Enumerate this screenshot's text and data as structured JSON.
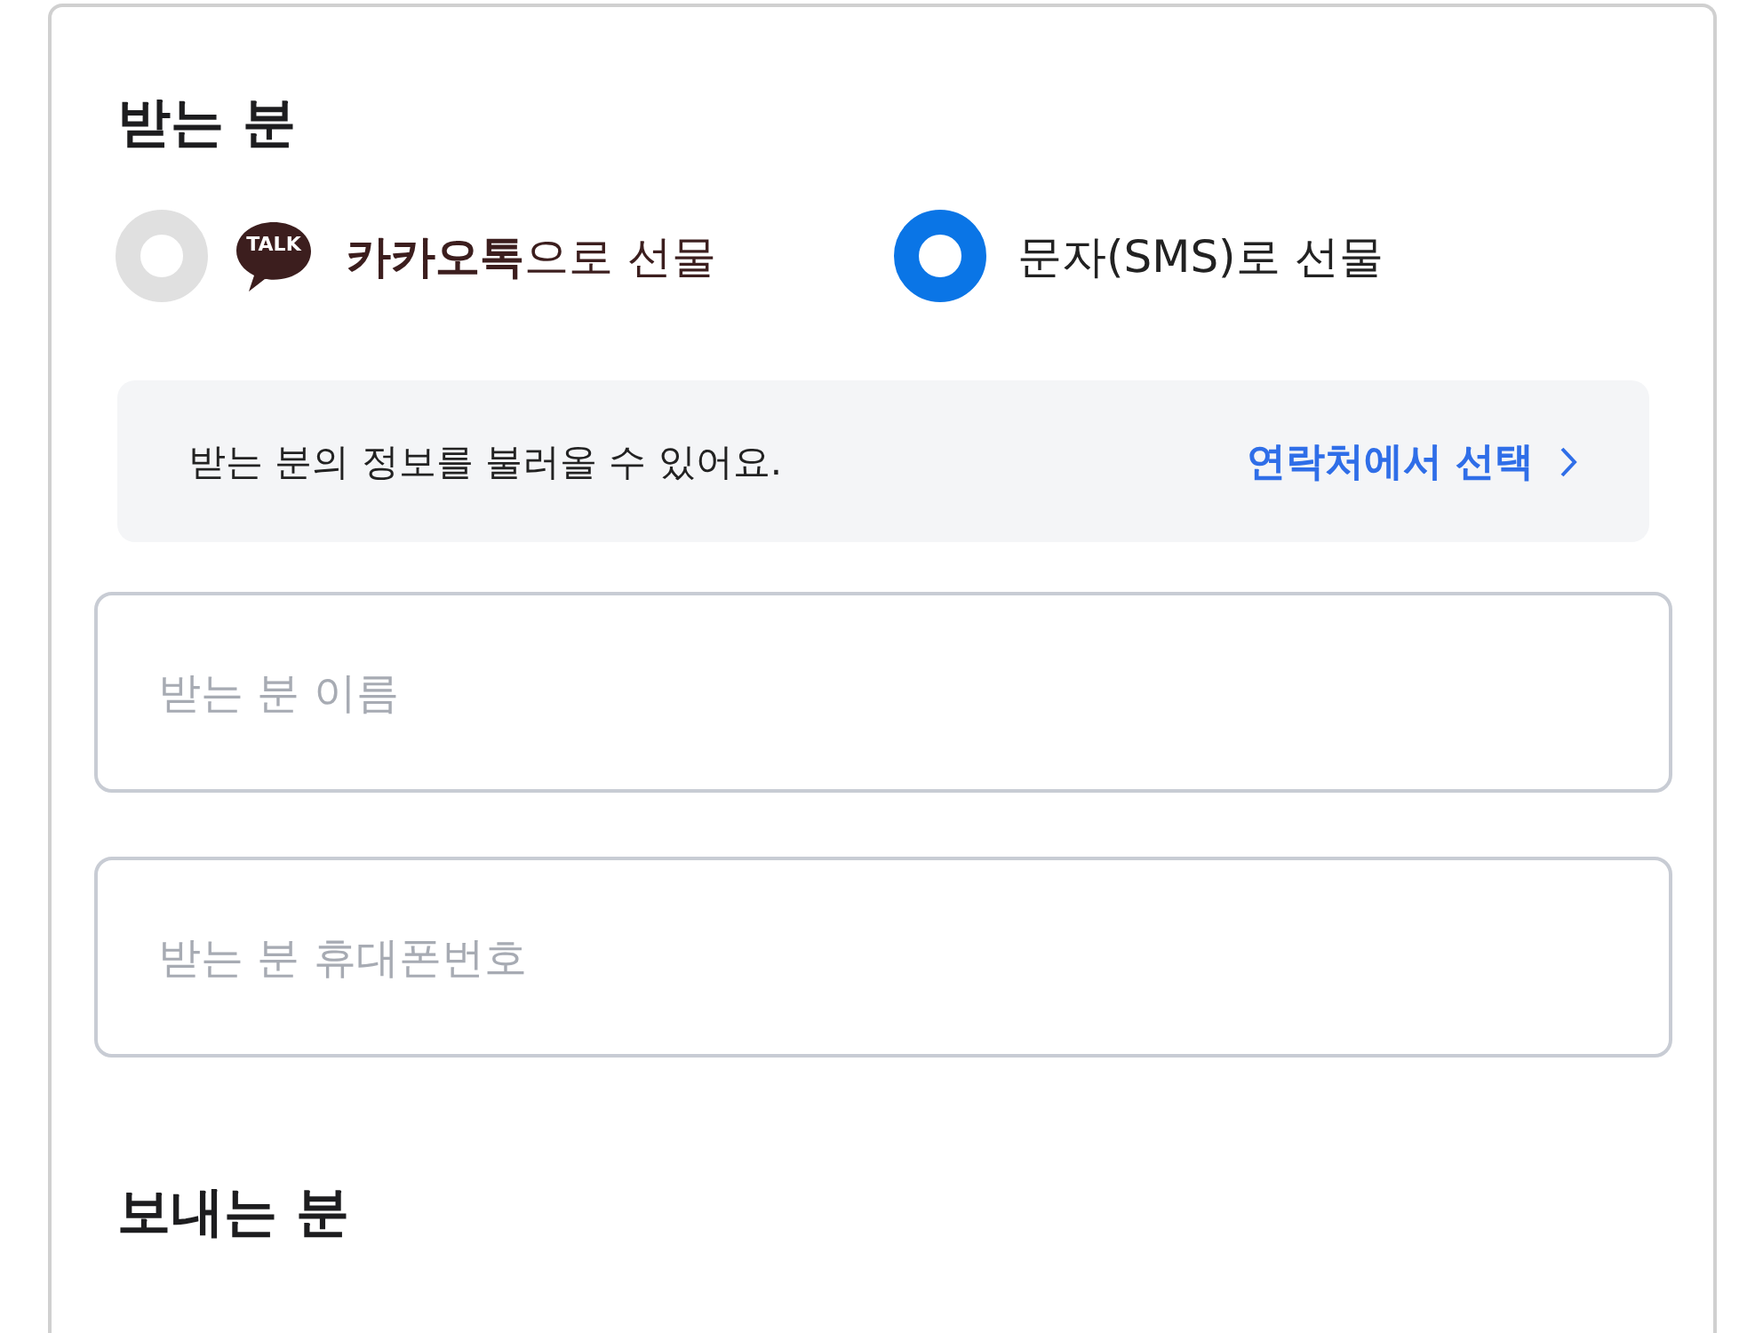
{
  "recipient_section": {
    "title": "받는 분"
  },
  "delivery_options": [
    {
      "kind": "kakao",
      "icon_text": "TALK",
      "label": "**카카오톡**으로 선물",
      "selected": false
    },
    {
      "kind": "sms",
      "label": "문자(SMS)로 선물",
      "selected": true
    }
  ],
  "contact_notice": {
    "text": "받는 분의 정보를 불러올 수 있어요.",
    "link": "연락처에서 선택"
  },
  "fields": [
    {
      "placeholder": "받는 분 이름"
    },
    {
      "placeholder": "받는 분 휴대폰번호"
    }
  ],
  "sender_section": {
    "title": "보내는 분"
  }
}
